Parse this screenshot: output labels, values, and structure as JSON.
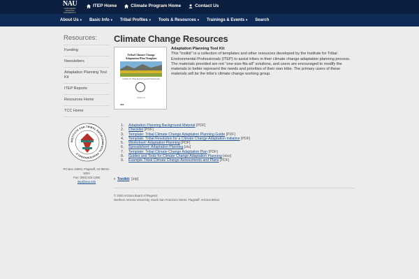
{
  "brand": {
    "logo_text": "NAU",
    "logo_sub": [
      "NORTHERN",
      "ARIZONA",
      "UNIVERSITY"
    ]
  },
  "toplinks": [
    {
      "label": "ITEP Home",
      "icon": "home-icon"
    },
    {
      "label": "Climate Program Home",
      "icon": "home-icon"
    },
    {
      "label": "Contact Us",
      "icon": "person-icon"
    }
  ],
  "nav": [
    {
      "label": "About Us",
      "caret": "▾"
    },
    {
      "label": "Basic Info",
      "caret": "▾"
    },
    {
      "label": "Tribal Profiles",
      "caret": "▾"
    },
    {
      "label": "Tools & Resources",
      "caret": "▾"
    },
    {
      "label": "Trainings & Events",
      "caret": "▾"
    },
    {
      "label": "Search",
      "caret": ""
    }
  ],
  "sidebar": {
    "title": "Resources:",
    "items": [
      "Funding",
      "Newsletters",
      "Adaptation Planning Tool Kit",
      "ITEP Reports",
      "Resources Home",
      "TCC Home"
    ]
  },
  "seal": {
    "ring_text": "INSTITUTE FOR TRIBAL ENVIRONMENTAL PROFESSIONALS"
  },
  "contact": {
    "address": "PO Box 15004, Flagstaff, AZ 86011-5004",
    "fax": "Fax: (928) 523-1266",
    "email": "itep@nau.edu"
  },
  "main": {
    "title": "Climate Change Resources",
    "cover": {
      "title": "Tribal Climate Change Adaptation Plan Template",
      "subtitle": "Institute for Tribal Environmental Professionals",
      "version": "Version 1.0",
      "footer": "ITEP"
    },
    "desc_heading": "Adaptation Planning Tool Kit",
    "desc_body": "This \"toolkit\" is a collection of templates and other resources developed by the Institute for Tribal Environmental Professionals (ITEP) to assist tribes in their climate change adaptation planning process. The materials provided are not \"one-size-fits-all\" solutions, and users are encouraged to modify the materials to better represent the needs and priorities of their own tribe. The primary users of these materials will be the tribe's climate change working group.",
    "documents": [
      {
        "num": "1.",
        "label": "Adaptation Planning Background Material",
        "format": "[PDF]"
      },
      {
        "num": "2.",
        "label": "Checklist",
        "format": "[PDF]"
      },
      {
        "num": "3.",
        "label": "Template: Tribal Climate Change Adaptation Planning Guide",
        "format": "[PDF]"
      },
      {
        "num": "4.",
        "label": "Template: Tribal Resolution for a Climate Change Adaptation Initiative",
        "format": "[PDF]"
      },
      {
        "num": "5.",
        "label": "Worksheet: Adaptation Planning",
        "format": "[PDF]"
      },
      {
        "num": "6.",
        "label": "Spreadsheet: Adaptation Planning",
        "format": "[xls]"
      },
      {
        "num": "7.",
        "label": "Template: Tribal Climate Change Adaptation Plan",
        "format": "[PDF]"
      },
      {
        "num": "8.",
        "label": "Guides and Tools for Climate Change Adaptation Planning",
        "format": "[xlsx]"
      },
      {
        "num": "9.",
        "label": "Example Tribal Climate Change Assessments and Plans",
        "format": "[PDF]"
      }
    ],
    "toolkit": {
      "chevron": "›",
      "label": "Toolkit",
      "format": "[zip]"
    }
  },
  "footer": {
    "line1": "© 2020 Arizona Board of Regents",
    "line2": "Northern Arizona University, South San Francisco Street, Flagstaff, Arizona 86011"
  },
  "colors": {
    "topbar": "#0a1f3f",
    "navbar": "#0f2a55",
    "link": "#1a4d8f",
    "background": "#ececec"
  }
}
